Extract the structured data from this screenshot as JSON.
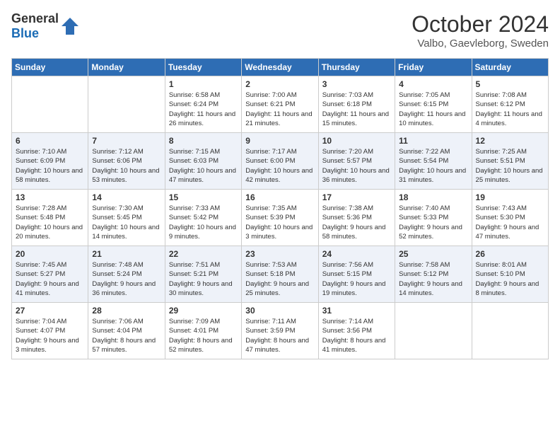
{
  "header": {
    "logo_general": "General",
    "logo_blue": "Blue",
    "month": "October 2024",
    "location": "Valbo, Gaevleborg, Sweden"
  },
  "weekdays": [
    "Sunday",
    "Monday",
    "Tuesday",
    "Wednesday",
    "Thursday",
    "Friday",
    "Saturday"
  ],
  "weeks": [
    [
      {
        "day": "",
        "sunrise": "",
        "sunset": "",
        "daylight": ""
      },
      {
        "day": "",
        "sunrise": "",
        "sunset": "",
        "daylight": ""
      },
      {
        "day": "1",
        "sunrise": "Sunrise: 6:58 AM",
        "sunset": "Sunset: 6:24 PM",
        "daylight": "Daylight: 11 hours and 26 minutes."
      },
      {
        "day": "2",
        "sunrise": "Sunrise: 7:00 AM",
        "sunset": "Sunset: 6:21 PM",
        "daylight": "Daylight: 11 hours and 21 minutes."
      },
      {
        "day": "3",
        "sunrise": "Sunrise: 7:03 AM",
        "sunset": "Sunset: 6:18 PM",
        "daylight": "Daylight: 11 hours and 15 minutes."
      },
      {
        "day": "4",
        "sunrise": "Sunrise: 7:05 AM",
        "sunset": "Sunset: 6:15 PM",
        "daylight": "Daylight: 11 hours and 10 minutes."
      },
      {
        "day": "5",
        "sunrise": "Sunrise: 7:08 AM",
        "sunset": "Sunset: 6:12 PM",
        "daylight": "Daylight: 11 hours and 4 minutes."
      }
    ],
    [
      {
        "day": "6",
        "sunrise": "Sunrise: 7:10 AM",
        "sunset": "Sunset: 6:09 PM",
        "daylight": "Daylight: 10 hours and 58 minutes."
      },
      {
        "day": "7",
        "sunrise": "Sunrise: 7:12 AM",
        "sunset": "Sunset: 6:06 PM",
        "daylight": "Daylight: 10 hours and 53 minutes."
      },
      {
        "day": "8",
        "sunrise": "Sunrise: 7:15 AM",
        "sunset": "Sunset: 6:03 PM",
        "daylight": "Daylight: 10 hours and 47 minutes."
      },
      {
        "day": "9",
        "sunrise": "Sunrise: 7:17 AM",
        "sunset": "Sunset: 6:00 PM",
        "daylight": "Daylight: 10 hours and 42 minutes."
      },
      {
        "day": "10",
        "sunrise": "Sunrise: 7:20 AM",
        "sunset": "Sunset: 5:57 PM",
        "daylight": "Daylight: 10 hours and 36 minutes."
      },
      {
        "day": "11",
        "sunrise": "Sunrise: 7:22 AM",
        "sunset": "Sunset: 5:54 PM",
        "daylight": "Daylight: 10 hours and 31 minutes."
      },
      {
        "day": "12",
        "sunrise": "Sunrise: 7:25 AM",
        "sunset": "Sunset: 5:51 PM",
        "daylight": "Daylight: 10 hours and 25 minutes."
      }
    ],
    [
      {
        "day": "13",
        "sunrise": "Sunrise: 7:28 AM",
        "sunset": "Sunset: 5:48 PM",
        "daylight": "Daylight: 10 hours and 20 minutes."
      },
      {
        "day": "14",
        "sunrise": "Sunrise: 7:30 AM",
        "sunset": "Sunset: 5:45 PM",
        "daylight": "Daylight: 10 hours and 14 minutes."
      },
      {
        "day": "15",
        "sunrise": "Sunrise: 7:33 AM",
        "sunset": "Sunset: 5:42 PM",
        "daylight": "Daylight: 10 hours and 9 minutes."
      },
      {
        "day": "16",
        "sunrise": "Sunrise: 7:35 AM",
        "sunset": "Sunset: 5:39 PM",
        "daylight": "Daylight: 10 hours and 3 minutes."
      },
      {
        "day": "17",
        "sunrise": "Sunrise: 7:38 AM",
        "sunset": "Sunset: 5:36 PM",
        "daylight": "Daylight: 9 hours and 58 minutes."
      },
      {
        "day": "18",
        "sunrise": "Sunrise: 7:40 AM",
        "sunset": "Sunset: 5:33 PM",
        "daylight": "Daylight: 9 hours and 52 minutes."
      },
      {
        "day": "19",
        "sunrise": "Sunrise: 7:43 AM",
        "sunset": "Sunset: 5:30 PM",
        "daylight": "Daylight: 9 hours and 47 minutes."
      }
    ],
    [
      {
        "day": "20",
        "sunrise": "Sunrise: 7:45 AM",
        "sunset": "Sunset: 5:27 PM",
        "daylight": "Daylight: 9 hours and 41 minutes."
      },
      {
        "day": "21",
        "sunrise": "Sunrise: 7:48 AM",
        "sunset": "Sunset: 5:24 PM",
        "daylight": "Daylight: 9 hours and 36 minutes."
      },
      {
        "day": "22",
        "sunrise": "Sunrise: 7:51 AM",
        "sunset": "Sunset: 5:21 PM",
        "daylight": "Daylight: 9 hours and 30 minutes."
      },
      {
        "day": "23",
        "sunrise": "Sunrise: 7:53 AM",
        "sunset": "Sunset: 5:18 PM",
        "daylight": "Daylight: 9 hours and 25 minutes."
      },
      {
        "day": "24",
        "sunrise": "Sunrise: 7:56 AM",
        "sunset": "Sunset: 5:15 PM",
        "daylight": "Daylight: 9 hours and 19 minutes."
      },
      {
        "day": "25",
        "sunrise": "Sunrise: 7:58 AM",
        "sunset": "Sunset: 5:12 PM",
        "daylight": "Daylight: 9 hours and 14 minutes."
      },
      {
        "day": "26",
        "sunrise": "Sunrise: 8:01 AM",
        "sunset": "Sunset: 5:10 PM",
        "daylight": "Daylight: 9 hours and 8 minutes."
      }
    ],
    [
      {
        "day": "27",
        "sunrise": "Sunrise: 7:04 AM",
        "sunset": "Sunset: 4:07 PM",
        "daylight": "Daylight: 9 hours and 3 minutes."
      },
      {
        "day": "28",
        "sunrise": "Sunrise: 7:06 AM",
        "sunset": "Sunset: 4:04 PM",
        "daylight": "Daylight: 8 hours and 57 minutes."
      },
      {
        "day": "29",
        "sunrise": "Sunrise: 7:09 AM",
        "sunset": "Sunset: 4:01 PM",
        "daylight": "Daylight: 8 hours and 52 minutes."
      },
      {
        "day": "30",
        "sunrise": "Sunrise: 7:11 AM",
        "sunset": "Sunset: 3:59 PM",
        "daylight": "Daylight: 8 hours and 47 minutes."
      },
      {
        "day": "31",
        "sunrise": "Sunrise: 7:14 AM",
        "sunset": "Sunset: 3:56 PM",
        "daylight": "Daylight: 8 hours and 41 minutes."
      },
      {
        "day": "",
        "sunrise": "",
        "sunset": "",
        "daylight": ""
      },
      {
        "day": "",
        "sunrise": "",
        "sunset": "",
        "daylight": ""
      }
    ]
  ]
}
